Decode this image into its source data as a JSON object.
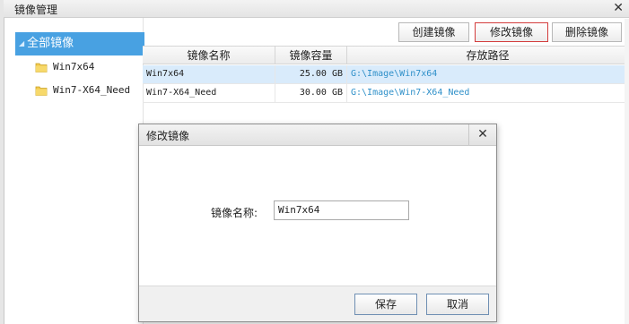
{
  "window": {
    "title": "镜像管理",
    "close_glyph": "✕"
  },
  "sidebar": {
    "root": {
      "label": "全部镜像"
    },
    "items": [
      {
        "label": "Win7x64",
        "icon": "folder-icon"
      },
      {
        "label": "Win7-X64_Need",
        "icon": "folder-icon"
      }
    ]
  },
  "toolbar": {
    "create_label": "创建镜像",
    "modify_label": "修改镜像",
    "delete_label": "删除镜像"
  },
  "table": {
    "headers": [
      "镜像名称",
      "镜像容量",
      "存放路径"
    ],
    "rows": [
      {
        "name": "Win7x64",
        "size": "25.00 GB",
        "path": "G:\\Image\\Win7x64",
        "selected": true
      },
      {
        "name": "Win7-X64_Need",
        "size": "30.00 GB",
        "path": "G:\\Image\\Win7-X64_Need",
        "selected": false
      }
    ]
  },
  "dialog": {
    "title": "修改镜像",
    "close_glyph": "✕",
    "name_label": "镜像名称:",
    "name_value": "Win7x64",
    "save_label": "保存",
    "cancel_label": "取消"
  },
  "colors": {
    "accent": "#48a1e2",
    "selected_row": "#d9ebfb",
    "path_text": "#2f90c9",
    "active_button_border": "#d33c3c"
  }
}
